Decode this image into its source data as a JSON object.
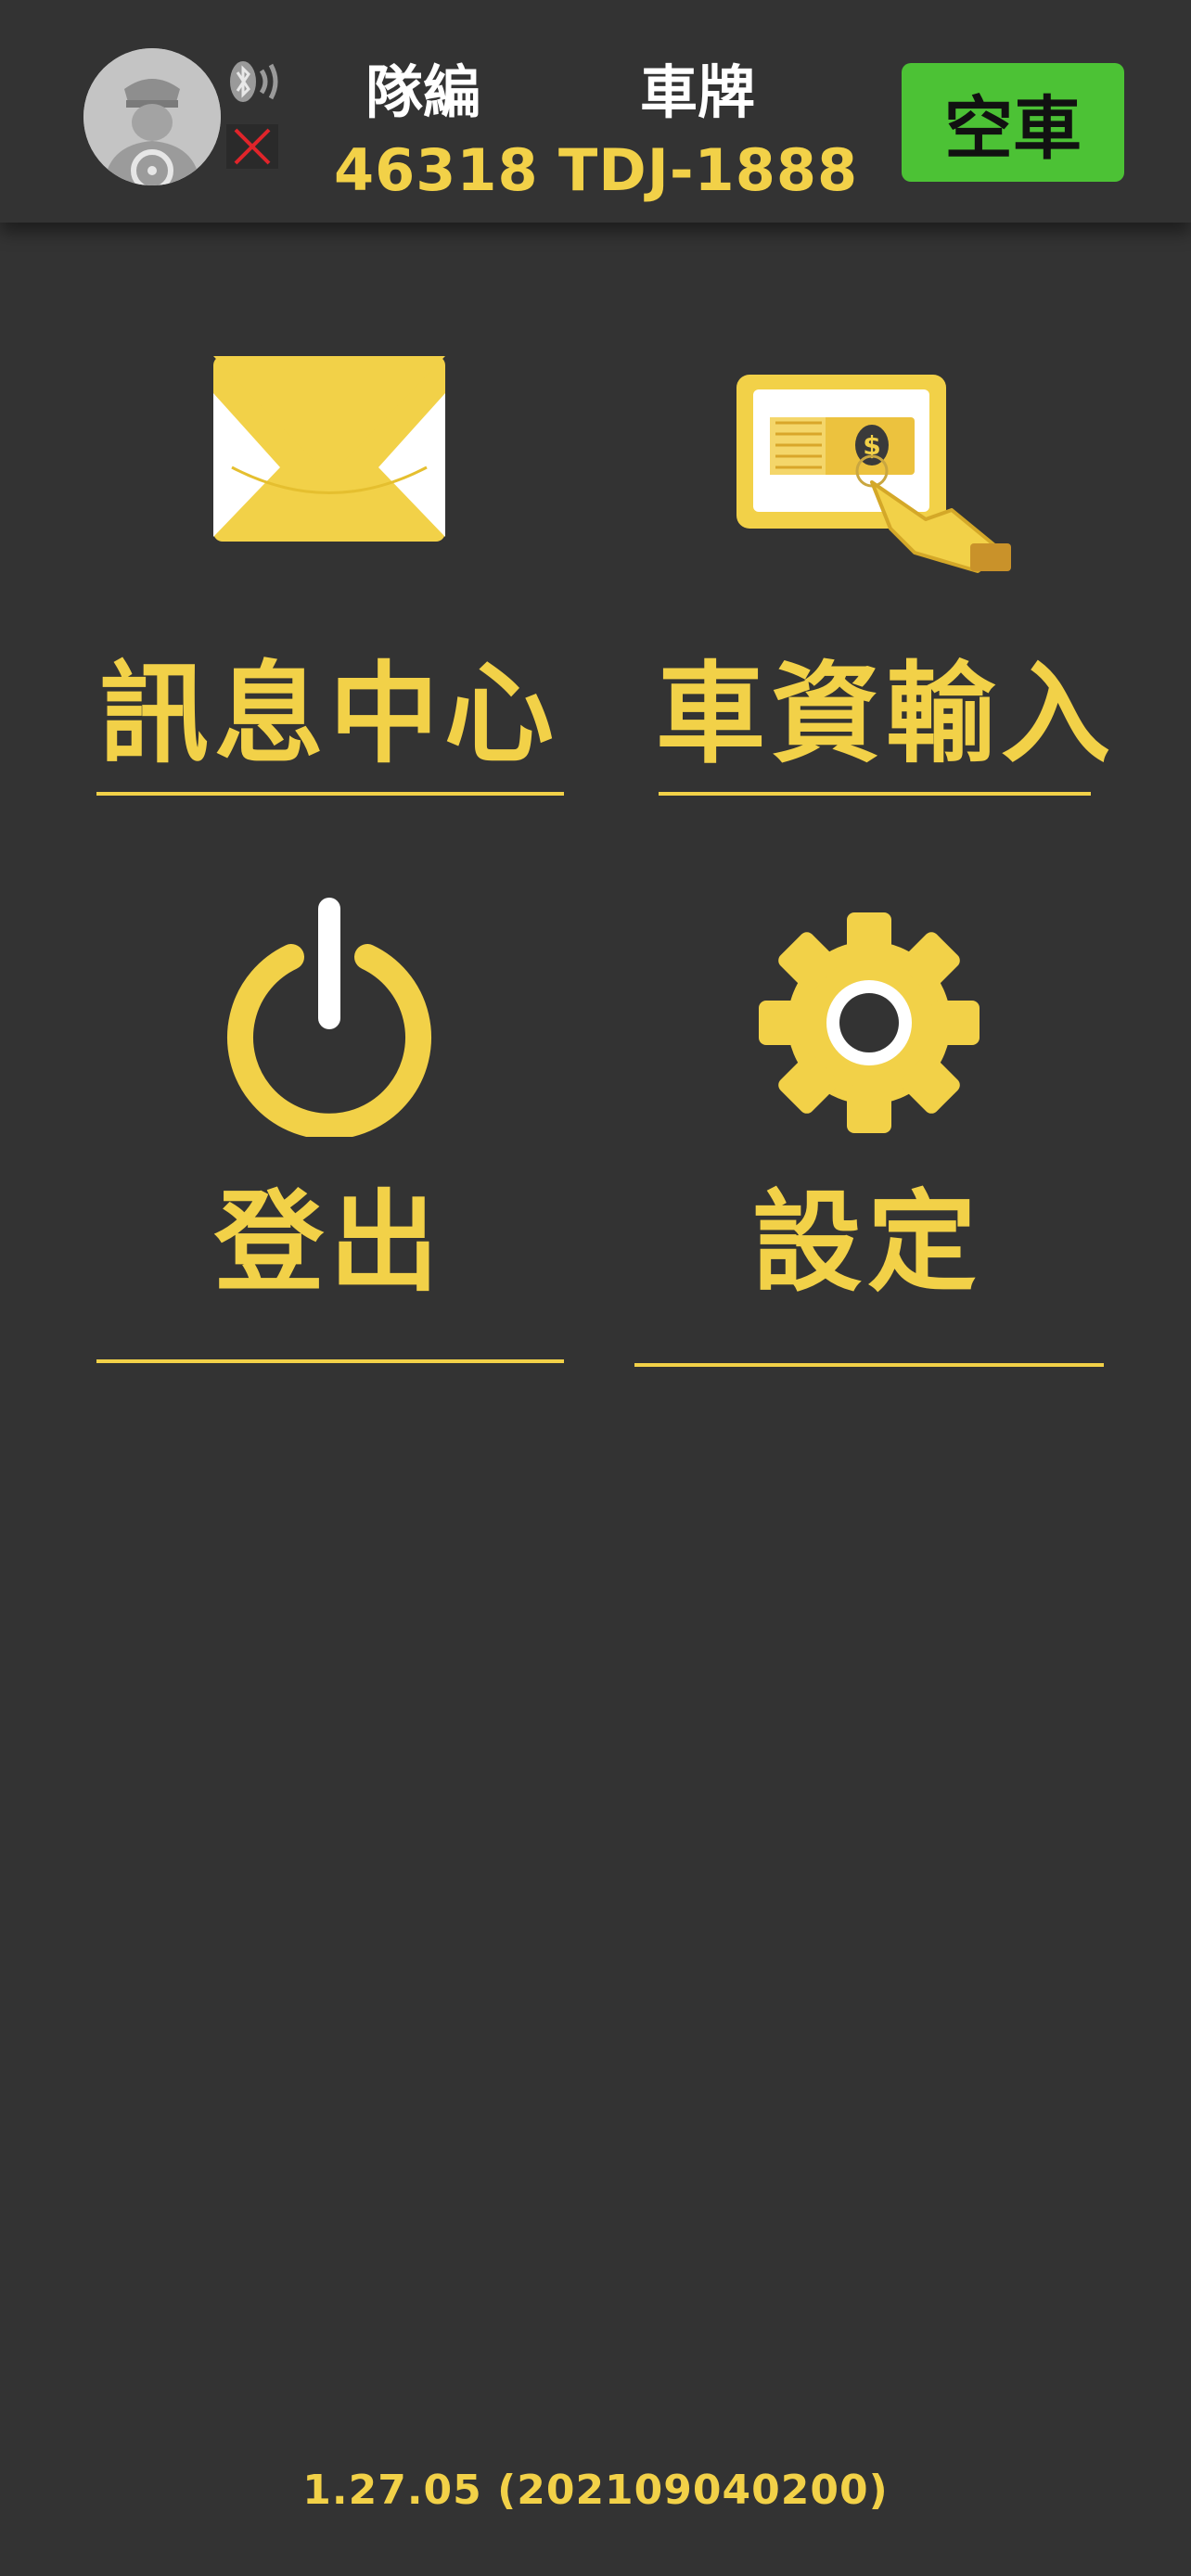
{
  "header": {
    "avatar_icon": "driver-avatar",
    "bluetooth_icon": "bluetooth-signal-icon",
    "error_icon": "red-x-icon",
    "fleet_label": "隊編",
    "fleet_value": "46318",
    "plate_label": "車牌",
    "plate_value": "TDJ-1888",
    "status_button": "空車",
    "status_color": "#4cc235"
  },
  "menu": {
    "message_center": {
      "label": "訊息中心",
      "icon": "envelope-icon"
    },
    "vehicle_input": {
      "label": "車資輸入",
      "icon": "money-card-tap-icon"
    },
    "logout": {
      "label": "登出",
      "icon": "power-icon"
    },
    "settings": {
      "label": "設定",
      "icon": "gear-icon"
    }
  },
  "footer": {
    "version": "1.27.05 (202109040200)"
  },
  "colors": {
    "background": "#333333",
    "accent": "#f2d148"
  }
}
